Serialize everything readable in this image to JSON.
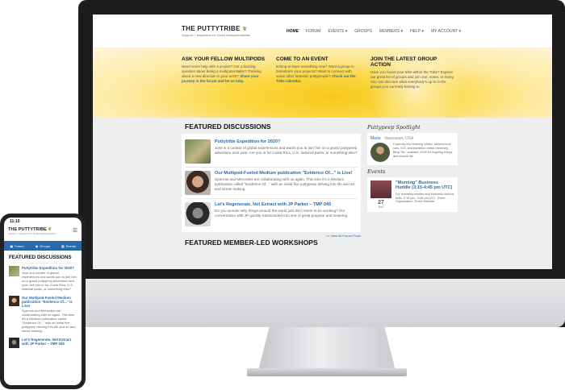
{
  "site": {
    "logo": "THE PUTTYTRIBE",
    "tagline": "Support + Inspiration for Serial Multipotentialites"
  },
  "nav": [
    {
      "label": "HOME",
      "active": true
    },
    {
      "label": "FORUM"
    },
    {
      "label": "EVENTS ▾"
    },
    {
      "label": "GROUPS"
    },
    {
      "label": "MEMBERS ▾"
    },
    {
      "label": "HELP ▾"
    },
    {
      "label": "MY ACCOUNT ▾"
    }
  ],
  "banner": [
    {
      "title": "ASK YOUR FELLOW MULTIPODS",
      "text": "Need some help with a project? Got a burning question about being a multipotentialite? Thinking about a new direction in your work?",
      "link": "Share your journey in the forum and let us help."
    },
    {
      "title": "COME TO AN EVENT",
      "text": "Itching to learn something new? Want a group to brainstorm your projects? Want to connect with some other fantastic puttypeople?",
      "link": "Check out the Tribe calendar."
    },
    {
      "title": "JOIN THE LATEST GROUP ACTION",
      "text": "Have you found your tribe within the Tribe? Explore our great list of groups and join one, some, or many. You can also see what everybody's up to in the groups you currently belong to."
    }
  ],
  "featured": {
    "title": "FEATURED DISCUSSIONS",
    "posts": [
      {
        "title": "Puttytribe Expedition for 2020?",
        "excerpt": "Jose is a curator of global experiences and wants you to join him on a grand puttypeep adventure next year. Are you in for Costa Rica, U.S. national parks, or something else?"
      },
      {
        "title": "Our Multipod-Fueled Medium publication \"Evidence Of...\" is Live!",
        "excerpt": "Sparrow and Mercedes are collaborating with us again. This time it's a Medium publication called \"Evidence Of...\" with an initial five puttypeep delving into life and art and sense making."
      },
      {
        "title": "Let's Regenerate, Not Extract with JP Parker – TMP 045",
        "excerpt": "Do you wonder why things around the world just don't seem to be working? Our conversation with JP quickly transcended into one of great purpose and meaning."
      }
    ],
    "view_all": ">> View All Forum Posts"
  },
  "workshops": {
    "title": "FEATURED MEMBER-LED WORKSHOPS"
  },
  "spotlight": {
    "title": "Puttypeep Spotlight",
    "name": "Mario",
    "location": "Vancouver, USA",
    "text": "Currently into learning Welsh, autonomous cars, ICS, and transition metal chemistry. Blog \"ML\" podcast; 2018 for inspiring things and shared life."
  },
  "events": {
    "title": "Events",
    "day": "27",
    "month": "Nov",
    "event_title": "\"Morning\" Business Huddle (3:15-4:45 pm UTC)",
    "event_text": "For business-minded and business-curious folks. 3:15 pm - 4:45 pm UTC. Event Organization. Event Website."
  },
  "phone": {
    "time": "11:15",
    "logo": "THE PUTTYTRIBE",
    "tagline": "Support + Inspiration for Serial Multipotentialites",
    "tabs": [
      {
        "icon": "forum-icon",
        "label": "Forum"
      },
      {
        "icon": "groups-icon",
        "label": "Groups"
      },
      {
        "icon": "events-icon",
        "label": "Events"
      }
    ],
    "featured_title": "FEATURED DISCUSSIONS",
    "posts": [
      {
        "title": "Puttytribe Expedition for 2020?",
        "excerpt": "Jose is a curator of global experiences and wants you to join him on a grand puttypeep adventure next year. Are you in for Costa Rica, U.S. national parks, or something else?"
      },
      {
        "title": "Our Multipod-Fueled Medium publication \"Evidence Of...\" is Live!",
        "excerpt": "Sparrow and Mercedes are collaborating with us again. This time it's a Medium publication called \"Evidence Of...\" with an initial five puttypeep delving into life and art and sense making."
      },
      {
        "title": "Let's Regenerate, Not Extract with JP Parker – TMP 045"
      }
    ]
  },
  "colors": {
    "accent": "#2a6aa8",
    "banner_yellow": "#f7c81c",
    "leaf_green": "#77b843"
  }
}
